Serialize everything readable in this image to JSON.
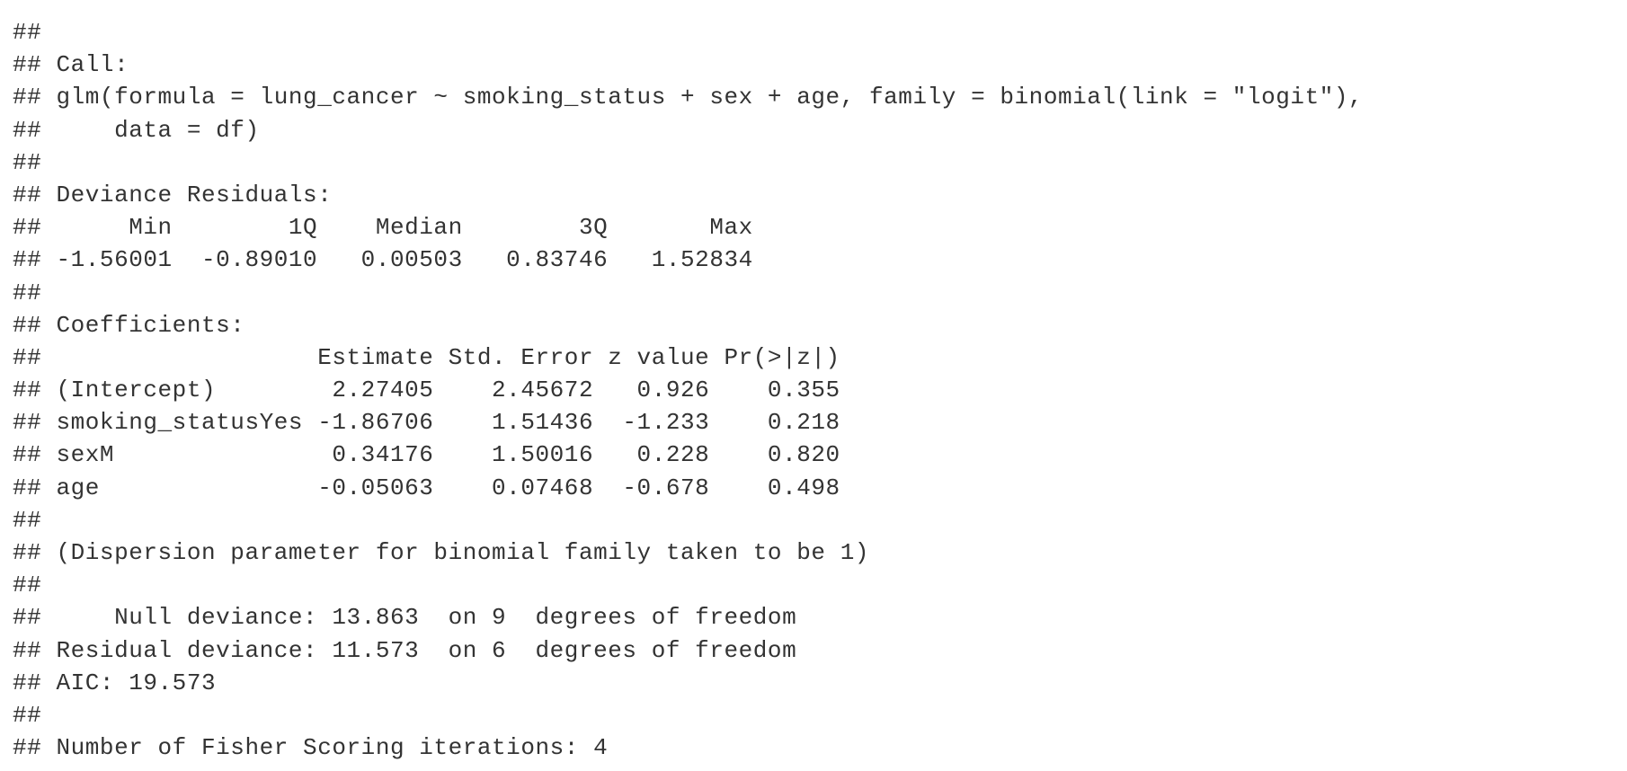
{
  "console_output": {
    "lines": [
      "##",
      "## Call:",
      "## glm(formula = lung_cancer ~ smoking_status + sex + age, family = binomial(link = \"logit\"),",
      "##     data = df)",
      "##",
      "## Deviance Residuals:",
      "##      Min        1Q    Median        3Q       Max",
      "## -1.56001  -0.89010   0.00503   0.83746   1.52834",
      "##",
      "## Coefficients:",
      "##                   Estimate Std. Error z value Pr(>|z|)",
      "## (Intercept)        2.27405    2.45672   0.926    0.355",
      "## smoking_statusYes -1.86706    1.51436  -1.233    0.218",
      "## sexM               0.34176    1.50016   0.228    0.820",
      "## age               -0.05063    0.07468  -0.678    0.498",
      "##",
      "## (Dispersion parameter for binomial family taken to be 1)",
      "##",
      "##     Null deviance: 13.863  on 9  degrees of freedom",
      "## Residual deviance: 11.573  on 6  degrees of freedom",
      "## AIC: 19.573",
      "##",
      "## Number of Fisher Scoring iterations: 4"
    ]
  }
}
